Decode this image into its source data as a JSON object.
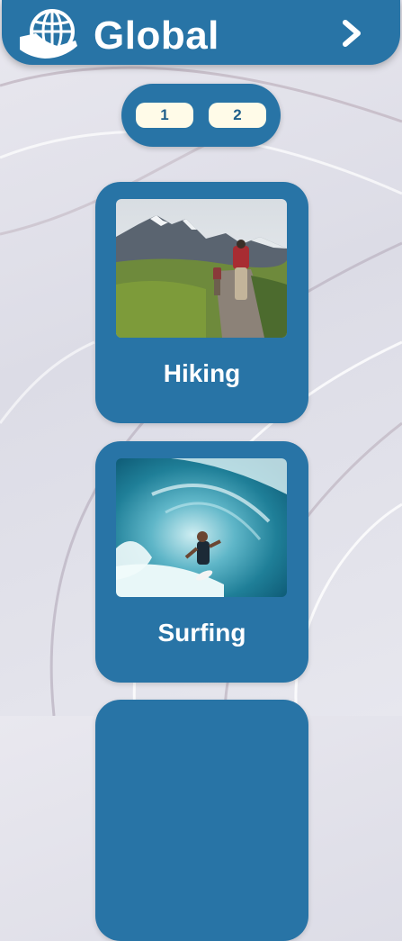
{
  "header": {
    "title": "Global",
    "logo_icon": "globe-hand-icon",
    "next_icon": "chevron-right-icon"
  },
  "pagination": {
    "pages": [
      "1",
      "2"
    ]
  },
  "activities": [
    {
      "label": "Hiking",
      "image": "hiking-photo"
    },
    {
      "label": "Surfing",
      "image": "surfing-photo"
    }
  ],
  "colors": {
    "primary": "#2874a6",
    "page_button": "#fffbe8",
    "page_button_text": "#1f5f8b"
  }
}
